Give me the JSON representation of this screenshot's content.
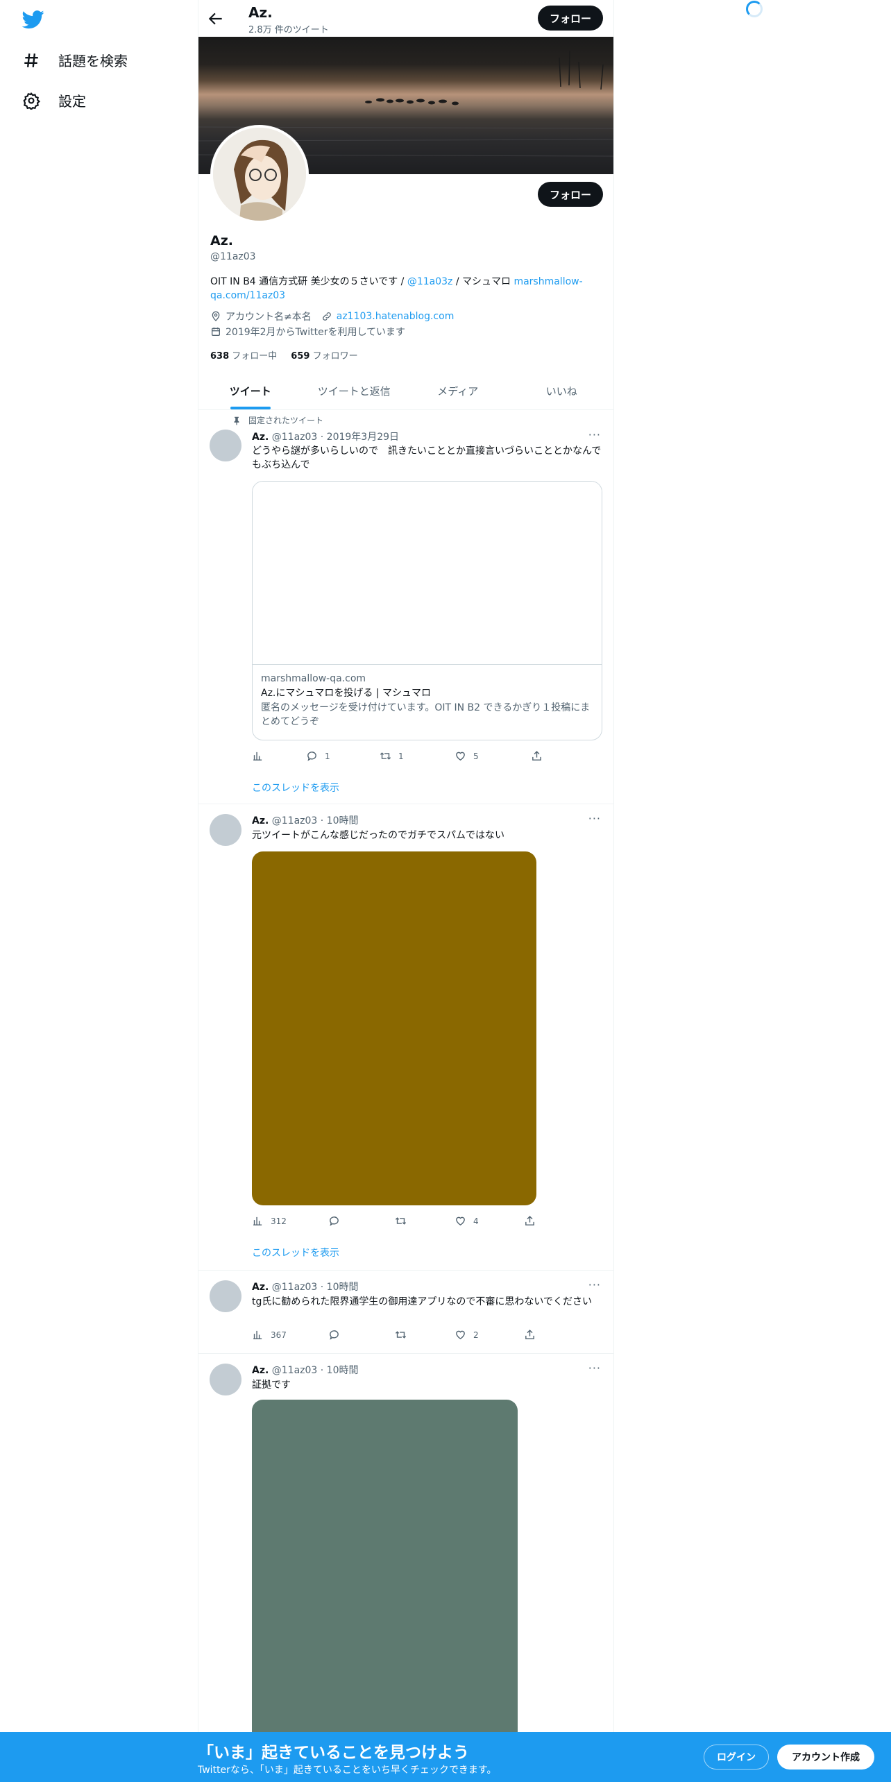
{
  "nav": {
    "explore_label": "話題を検索",
    "settings_label": "設定"
  },
  "header": {
    "name": "Az.",
    "tweet_count": "2.8万 件のツイート",
    "follow_label": "フォロー"
  },
  "profile": {
    "follow_label": "フォロー",
    "name": "Az.",
    "handle": "@11az03",
    "bio_text": "OIT IN B4 通信方式研 美少女の５さいです / ",
    "bio_mention": "@11a03z",
    "bio_mid": " / マシュマロ ",
    "bio_link": "marshmallow-qa.com/11az03",
    "location": "アカウント名≠本名",
    "website": "az1103.hatenablog.com",
    "joined": "2019年2月からTwitterを利用しています",
    "following_count": "638",
    "following_label": "フォロー中",
    "followers_count": "659",
    "followers_label": "フォロワー"
  },
  "tabs": [
    {
      "label": "ツイート"
    },
    {
      "label": "ツイートと返信"
    },
    {
      "label": "メディア"
    },
    {
      "label": "いいね"
    }
  ],
  "tweets": [
    {
      "pinned_label": "固定されたツイート",
      "name": "Az.",
      "meta": "@11az03 · 2019年3月29日",
      "text": "どうやら謎が多いらしいので　訊きたいこととか直接言いづらいこととかなんでもぶち込んで",
      "card_domain": "marshmallow-qa.com",
      "card_title": "Az.にマシュマロを投げる | マシュマロ",
      "card_desc": "匿名のメッセージを受け付けています。OIT IN B2 できるかぎり１投稿にまとめてどうぞ",
      "views": "",
      "replies": "1",
      "retweets": "1",
      "likes": "5",
      "show_thread": "このスレッドを表示"
    },
    {
      "name": "Az.",
      "meta": "@11az03 · 10時間",
      "text": "元ツイートがこんな感じだったのでガチでスパムではない",
      "media_color": "#8a6800",
      "views": "312",
      "replies": "",
      "retweets": "",
      "likes": "4",
      "show_thread": "このスレッドを表示"
    },
    {
      "name": "Az.",
      "meta": "@11az03 · 10時間",
      "text": "tg氏に勧められた限界通学生の御用達アプリなので不審に思わないでください",
      "views": "367",
      "replies": "",
      "retweets": "",
      "likes": "2"
    },
    {
      "name": "Az.",
      "meta": "@11az03 · 10時間",
      "text": "証拠です",
      "media_color": "#5e7a70"
    }
  ],
  "bottom_bar": {
    "title": "「いま」起きていることを見つけよう",
    "subtitle": "Twitterなら、「いま」起きていることをいち早くチェックできます。",
    "login_label": "ログイン",
    "signup_label": "アカウント作成"
  },
  "colors": {
    "accent": "#1d9bf0",
    "text": "#0f1419",
    "muted": "#536471"
  }
}
